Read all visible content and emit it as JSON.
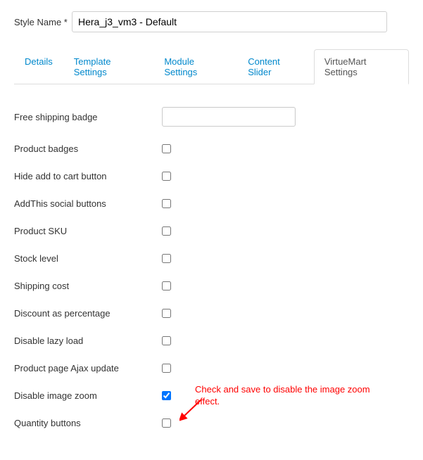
{
  "styleName": {
    "label": "Style Name *",
    "value": "Hera_j3_vm3 - Default"
  },
  "tabs": [
    {
      "label": "Details",
      "active": false
    },
    {
      "label": "Template Settings",
      "active": false
    },
    {
      "label": "Module Settings",
      "active": false
    },
    {
      "label": "Content Slider",
      "active": false
    },
    {
      "label": "VirtueMart Settings",
      "active": true
    }
  ],
  "settings": {
    "freeShippingBadge": {
      "label": "Free shipping badge",
      "type": "text",
      "value": ""
    },
    "productBadges": {
      "label": "Product badges",
      "type": "checkbox",
      "checked": false
    },
    "hideAddToCart": {
      "label": "Hide add to cart button",
      "type": "checkbox",
      "checked": false
    },
    "addThisSocial": {
      "label": "AddThis social buttons",
      "type": "checkbox",
      "checked": false
    },
    "productSku": {
      "label": "Product SKU",
      "type": "checkbox",
      "checked": false
    },
    "stockLevel": {
      "label": "Stock level",
      "type": "checkbox",
      "checked": false
    },
    "shippingCost": {
      "label": "Shipping cost",
      "type": "checkbox",
      "checked": false
    },
    "discountPercentage": {
      "label": "Discount as percentage",
      "type": "checkbox",
      "checked": false
    },
    "disableLazyLoad": {
      "label": "Disable lazy load",
      "type": "checkbox",
      "checked": false
    },
    "productPageAjax": {
      "label": "Product page Ajax update",
      "type": "checkbox",
      "checked": false
    },
    "disableImageZoom": {
      "label": "Disable image zoom",
      "type": "checkbox",
      "checked": true
    },
    "quantityButtons": {
      "label": "Quantity buttons",
      "type": "checkbox",
      "checked": false
    }
  },
  "annotation": {
    "text": "Check and save to disable the image zoom effect.",
    "color": "#ff0000"
  }
}
